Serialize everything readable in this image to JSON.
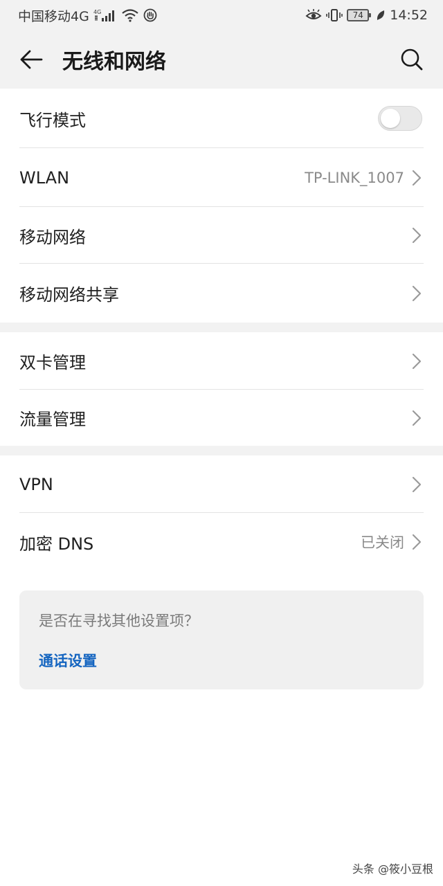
{
  "status_bar": {
    "carrier": "中国移动4G",
    "net_badge": "4G",
    "battery": "74",
    "time": "14:52"
  },
  "app_bar": {
    "title": "无线和网络"
  },
  "group1": {
    "airplane": {
      "label": "飞行模式",
      "enabled": false
    },
    "wlan": {
      "label": "WLAN",
      "value": "TP-LINK_1007"
    },
    "mobile_network": {
      "label": "移动网络"
    },
    "tethering": {
      "label": "移动网络共享"
    }
  },
  "group2": {
    "dual_sim": {
      "label": "双卡管理"
    },
    "data_usage": {
      "label": "流量管理"
    }
  },
  "group3": {
    "vpn": {
      "label": "VPN"
    },
    "private_dns": {
      "label": "加密 DNS",
      "value": "已关闭"
    }
  },
  "suggestion": {
    "question": "是否在寻找其他设置项？",
    "link": "通话设置"
  },
  "watermark": "头条 @筱小豆根",
  "colors": {
    "background": "#ffffff",
    "bar_background": "#f2f2f2",
    "link": "#1565c0",
    "secondary_text": "#8a8a8a"
  }
}
